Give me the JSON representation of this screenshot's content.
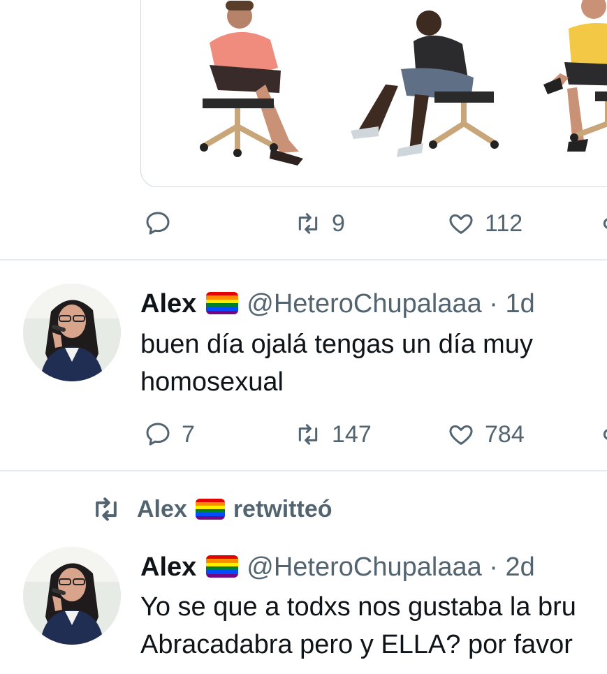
{
  "tweet1": {
    "actions": {
      "replies": "",
      "retweets": "9",
      "likes": "112"
    }
  },
  "tweet2": {
    "name": "Alex",
    "handle": "@HeteroChupalaaa",
    "separator": "·",
    "time": "1d",
    "text_line1": "buen día ojalá tengas un día muy",
    "text_line2": "homosexual",
    "actions": {
      "replies": "7",
      "retweets": "147",
      "likes": "784"
    }
  },
  "retweet_context": {
    "name": "Alex",
    "label": "retwitteó"
  },
  "tweet3": {
    "name": "Alex",
    "handle": "@HeteroChupalaaa",
    "separator": "·",
    "time": "2d",
    "text_line1": "Yo se que a todxs nos gustaba la bru",
    "text_line2": "Abracadabra pero y ELLA? por favor"
  },
  "icons": {
    "reply": "speech-bubble-icon",
    "retweet": "retweet-arrows-icon",
    "like": "heart-icon",
    "share": "share-icon"
  },
  "colors": {
    "secondary_text": "#536471",
    "primary_text": "#0f1419",
    "divider": "#e6ecf0",
    "pride_flag": [
      "#e40303",
      "#ff8c00",
      "#ffed00",
      "#008026",
      "#004dff",
      "#750787"
    ]
  }
}
